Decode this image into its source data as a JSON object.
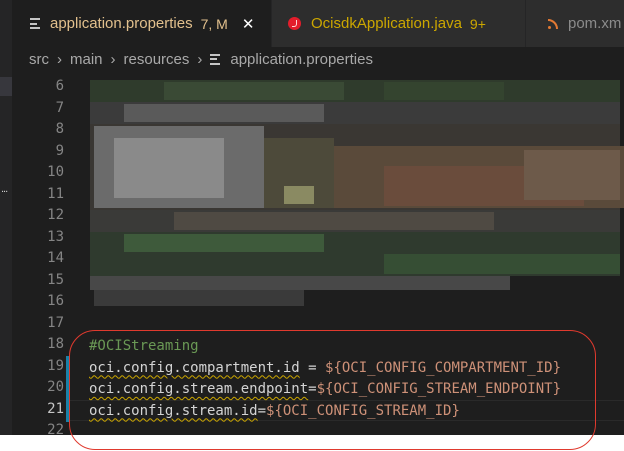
{
  "editor": {
    "tabs": [
      {
        "label": "application.properties",
        "badge": "7, M",
        "close_glyph": "✕",
        "icon": "properties-file-icon",
        "active": true
      },
      {
        "label": "OcisdkApplication.java",
        "badge": "9+",
        "icon": "java-file-icon",
        "active": false
      },
      {
        "label": "pom.xm",
        "icon": "xml-file-icon",
        "active": false
      }
    ],
    "breadcrumb": [
      "src",
      "main",
      "resources",
      "application.properties"
    ],
    "breadcrumb_separator": "›",
    "line_numbers": [
      "6",
      "7",
      "8",
      "9",
      "10",
      "11",
      "12",
      "13",
      "14",
      "15",
      "16",
      "17",
      "18",
      "19",
      "20",
      "21",
      "22"
    ],
    "active_line": "21",
    "code": {
      "comment": "#OCIStreaming",
      "lines": [
        {
          "key": "oci.config.compartment.id",
          "eq": " = ",
          "value": "${OCI_CONFIG_COMPARTMENT_ID}"
        },
        {
          "key": "oci.config.stream.endpoint",
          "eq": "=",
          "value": "${OCI_CONFIG_STREAM_ENDPOINT}"
        },
        {
          "key": "oci.config.stream.id",
          "eq": "=",
          "value": "${OCI_CONFIG_STREAM_ID}"
        }
      ]
    },
    "sidebar_dots": "...",
    "colors": {
      "editor_bg": "#1e1e1e",
      "modified_tab": "#e2c08d",
      "warning_tab": "#cca700",
      "comment": "#6a9955",
      "string": "#ce9178",
      "git_modified": "#1b81a8",
      "highlight_oval": "#e03a2e"
    }
  }
}
